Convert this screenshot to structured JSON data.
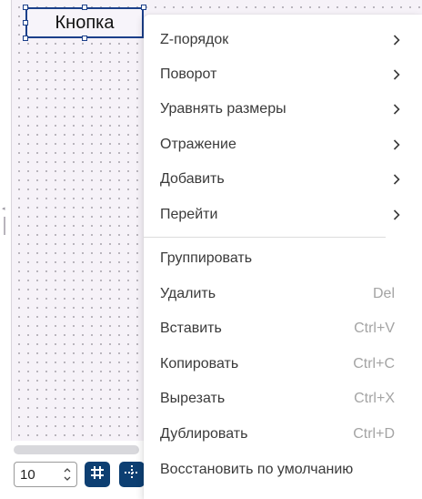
{
  "canvas": {
    "widget_label": "Кнопка"
  },
  "bottom_bar": {
    "grid_size_value": "10",
    "grid_toggle_icon": "grid-icon",
    "snap_toggle_icon": "snap-crosshair-icon"
  },
  "context_menu": {
    "items": [
      {
        "label": "Z-порядок",
        "submenu": true
      },
      {
        "label": "Поворот",
        "submenu": true
      },
      {
        "label": "Уравнять размеры",
        "submenu": true
      },
      {
        "label": "Отражение",
        "submenu": true
      },
      {
        "label": "Добавить",
        "submenu": true
      },
      {
        "label": "Перейти",
        "submenu": true
      },
      {
        "label": "Группировать",
        "shortcut": ""
      },
      {
        "label": "Удалить",
        "shortcut": "Del"
      },
      {
        "label": "Вставить",
        "shortcut": "Ctrl+V"
      },
      {
        "label": "Копировать",
        "shortcut": "Ctrl+C"
      },
      {
        "label": "Вырезать",
        "shortcut": "Ctrl+X"
      },
      {
        "label": "Дублировать",
        "shortcut": "Ctrl+D"
      },
      {
        "label": "Восстановить по умолчанию",
        "shortcut": ""
      }
    ]
  },
  "colors": {
    "selection": "#1b3f8a",
    "toolbar_button": "#0d3f72",
    "canvas_bg": "#f6f2f8"
  }
}
